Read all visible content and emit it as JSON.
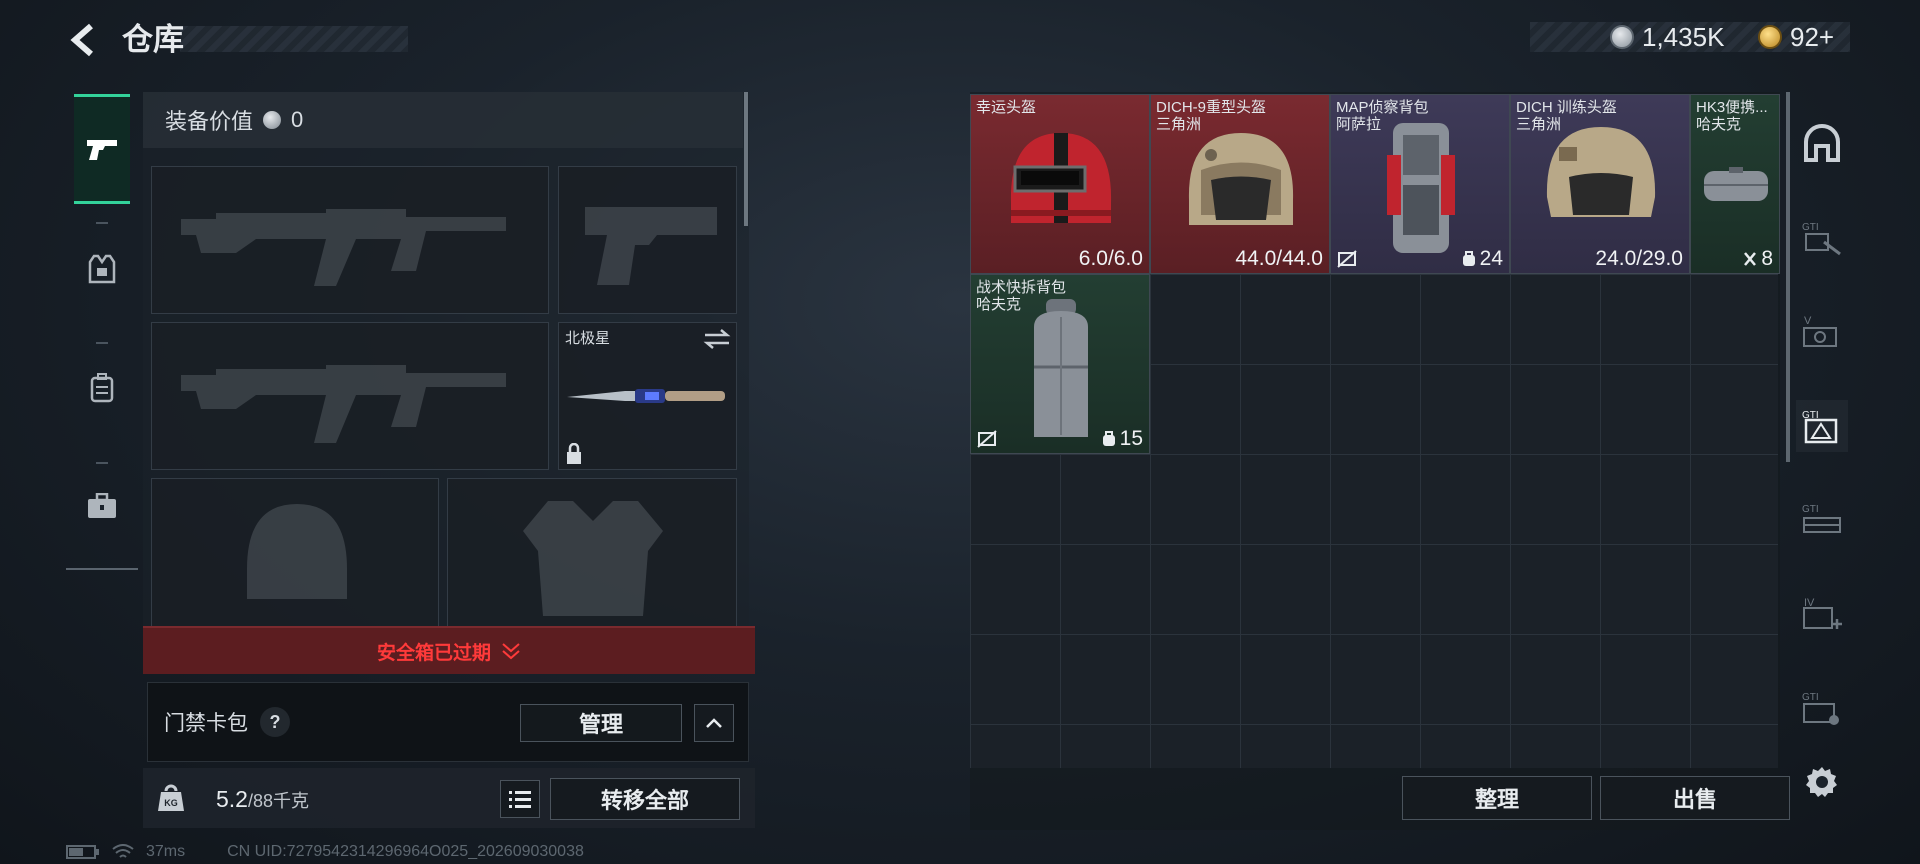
{
  "header": {
    "title": "仓库",
    "currency_silver": "1,435K",
    "currency_gold": "92+"
  },
  "equipment": {
    "value_label": "装备价值",
    "value": "0",
    "melee_name": "北极星",
    "safebox_status": "安全箱已过期",
    "card_pack_label": "门禁卡包",
    "card_pack_help": "?",
    "manage_button": "管理",
    "weight_current": "5.2",
    "weight_max": "/88千克",
    "transfer_all_button": "转移全部"
  },
  "stash": {
    "items": [
      {
        "name": "幸运头盔",
        "origin": "",
        "value": "6.0/6.0",
        "rarity": "red"
      },
      {
        "name": "DICH-9重型头盔",
        "origin": "三角洲",
        "value": "44.0/44.0",
        "rarity": "red"
      },
      {
        "name": "MAP侦察背包",
        "origin": "阿萨拉",
        "value": "24",
        "rarity": "purple"
      },
      {
        "name": "DICH 训练头盔",
        "origin": "三角洲",
        "value": "24.0/29.0",
        "rarity": "purple"
      },
      {
        "name": "HK3便携...",
        "origin": "哈夫克",
        "value": "8",
        "rarity": "green"
      },
      {
        "name": "战术快拆背包",
        "origin": "哈夫克",
        "value": "15",
        "rarity": "green"
      }
    ],
    "sort_button": "整理",
    "sell_button": "出售"
  },
  "status": {
    "ping": "37ms",
    "uid": "CN UID:7279542314296964O025_202609030038"
  },
  "colors": {
    "accent_green": "#33d29a",
    "rarity_red": "#6a2a2e",
    "rarity_purple": "#3a3550",
    "rarity_green": "#1e3a2e",
    "alert_red": "#ff3a3a"
  }
}
